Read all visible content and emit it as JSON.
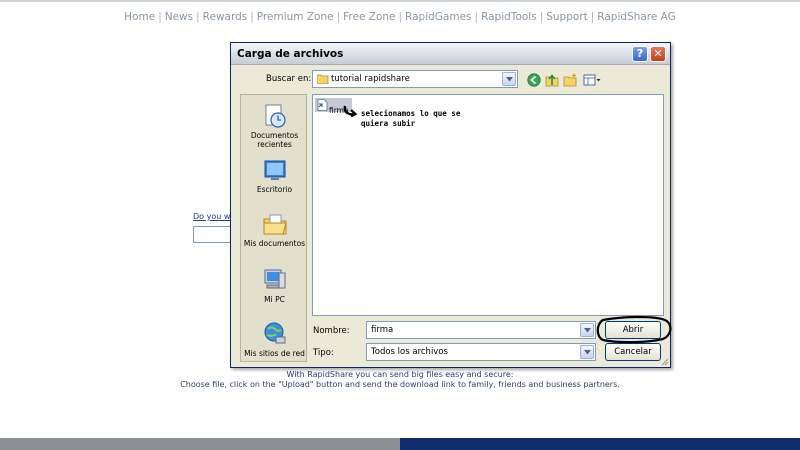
{
  "topnav": {
    "links": [
      "Home",
      "News",
      "Rewards",
      "Premium Zone",
      "Free Zone",
      "RapidGames",
      "RapidTools",
      "Support",
      "RapidShare AG"
    ],
    "separator": "|"
  },
  "background": {
    "question_text": "Do you wa",
    "info_line1": "With RapidShare you can send big files easy and secure:",
    "info_line2": "Choose file, click on the \"Upload\" button and send the download link to family, friends and business partners."
  },
  "dialog": {
    "title": "Carga de archivos",
    "help_label": "?",
    "close_label": "✕",
    "look_in_label": "Buscar en:",
    "look_in_value": "tutorial rapidshare",
    "toolbar_icons": [
      "back-icon",
      "up-folder-icon",
      "new-folder-icon",
      "views-menu-icon"
    ],
    "places": [
      {
        "label": "Documentos recientes",
        "icon": "recent-documents-icon"
      },
      {
        "label": "Escritorio",
        "icon": "desktop-icon"
      },
      {
        "label": "Mis documentos",
        "icon": "my-documents-icon"
      },
      {
        "label": "Mi PC",
        "icon": "my-computer-icon"
      },
      {
        "label": "Mis sitios de red",
        "icon": "network-places-icon"
      }
    ],
    "files": [
      {
        "name": "firma",
        "selected": true
      }
    ],
    "annotation_line1": "selecionamos lo que se",
    "annotation_line2": "quiera subir",
    "filename_label": "Nombre:",
    "filename_value": "firma",
    "filetype_label": "Tipo:",
    "filetype_value": "Todos los archivos",
    "open_button": "Abrir",
    "cancel_button": "Cancelar"
  },
  "colors": {
    "nav_text": "#8a96a3",
    "link_blue": "#1b3f8b",
    "footer_gray": "#8b8f93",
    "footer_navy": "#102b6b",
    "dialog_face": "#ece9d8",
    "selection": "#c4c9d3"
  }
}
